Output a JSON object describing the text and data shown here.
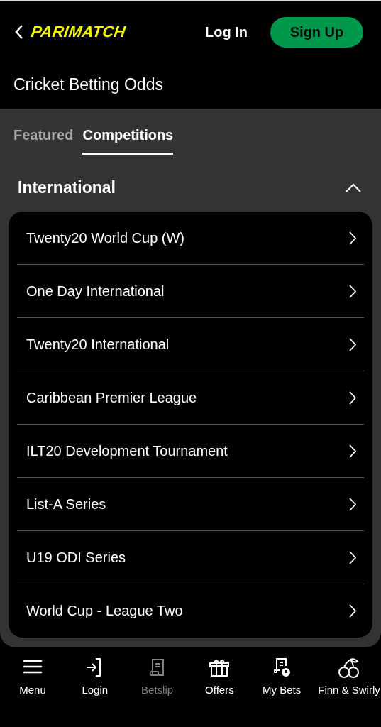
{
  "header": {
    "logo": "PARIMATCH",
    "login": "Log In",
    "signup": "Sign Up"
  },
  "page_title": "Cricket Betting Odds",
  "tabs": [
    {
      "label": "Featured",
      "selected": false
    },
    {
      "label": "Competitions",
      "selected": true
    }
  ],
  "section": {
    "title": "International",
    "expanded": true,
    "items": [
      "Twenty20 World Cup (W)",
      "One Day International",
      "Twenty20 International",
      "Caribbean Premier League",
      "ILT20 Development Tournament",
      "List-A Series",
      "U19 ODI Series",
      "World Cup - League Two"
    ]
  },
  "bottom_nav": [
    {
      "kind": "menu",
      "label": "Menu",
      "disabled": false
    },
    {
      "kind": "login",
      "label": "Login",
      "disabled": false
    },
    {
      "kind": "betslip",
      "label": "Betslip",
      "disabled": true
    },
    {
      "kind": "offers",
      "label": "Offers",
      "disabled": false
    },
    {
      "kind": "mybets",
      "label": "My Bets",
      "disabled": false
    },
    {
      "kind": "cherries",
      "label": "Finn & Swirly",
      "disabled": false
    }
  ]
}
